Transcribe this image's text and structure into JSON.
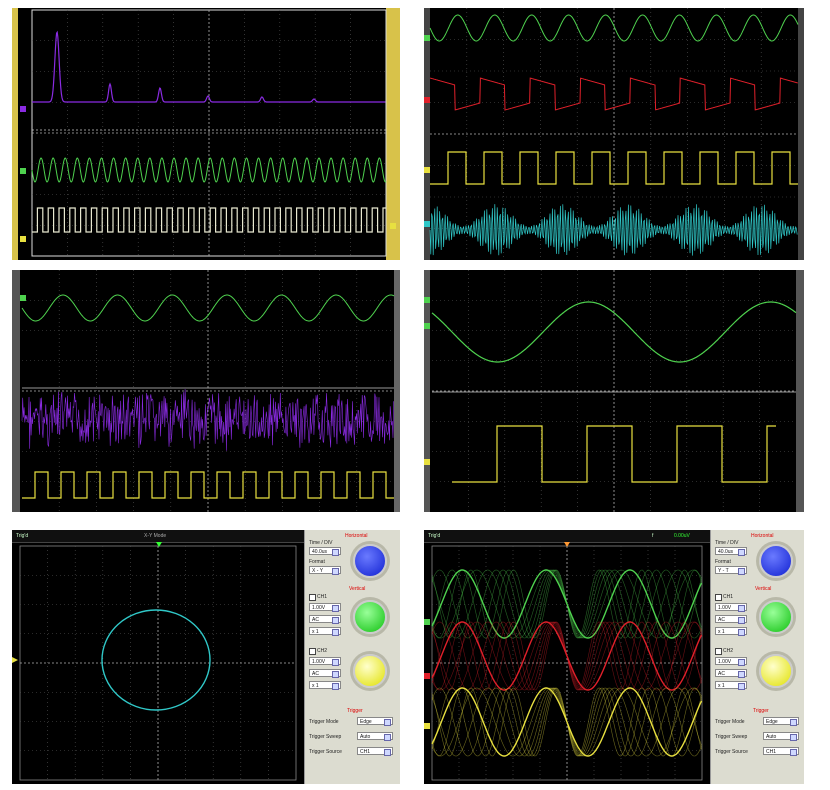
{
  "panels": [
    {
      "id": "p1",
      "desc": "fft-with-two-channels"
    },
    {
      "id": "p2",
      "desc": "four-channel-waveforms"
    },
    {
      "id": "p3",
      "desc": "sine-noise-square"
    },
    {
      "id": "p4",
      "desc": "sine-and-square"
    },
    {
      "id": "p5",
      "desc": "xy-mode-circle"
    },
    {
      "id": "p6",
      "desc": "persistence-display"
    }
  ],
  "colors": {
    "ch_purple": "#8a2be2",
    "ch_green": "#4fd24f",
    "ch_red": "#e0202a",
    "ch_yellow": "#e8e040",
    "ch_cyan": "#30c8c8",
    "grid": "#555555",
    "knob_blue": "#2030ff",
    "knob_green": "#20e020",
    "knob_yellow": "#f0f000"
  },
  "p5": {
    "topbar_left": "Trig'd",
    "topbar_mid": "X-Y Mode",
    "sidebar": {
      "horizontal": "Horizontal",
      "time_div_label": "Time / DIV",
      "time_div_value": "40.0us",
      "format_label": "Format",
      "format_value": "X - Y",
      "vertical": "Vertical",
      "ch1_label": "CH1",
      "ch1_volts": "1.00V",
      "ch1_coupling": "AC",
      "ch1_probe": "x 1",
      "ch2_label": "CH2",
      "ch2_volts": "1.00V",
      "ch2_coupling": "AC",
      "ch2_probe": "x 1",
      "trigger": "Trigger",
      "trigger_mode_label": "Trigger Mode",
      "trigger_mode_value": "Edge",
      "trigger_sweep_label": "Trigger Sweep",
      "trigger_sweep_value": "Auto",
      "trigger_source_label": "Trigger Source",
      "trigger_source_value": "CH1"
    }
  },
  "p6": {
    "topbar_left": "Trig'd",
    "topbar_right": "f",
    "topbar_right2": "0.00uV",
    "sidebar": {
      "horizontal": "Horizontal",
      "time_div_label": "Time / DIV",
      "time_div_value": "40.0us",
      "format_label": "Format",
      "format_value": "Y - T",
      "vertical": "Vertical",
      "ch1_label": "CH1",
      "ch1_volts": "1.00V",
      "ch1_coupling": "AC",
      "ch1_probe": "x 1",
      "ch2_label": "CH2",
      "ch2_volts": "1.00V",
      "ch2_coupling": "AC",
      "ch2_probe": "x 1",
      "trigger": "Trigger",
      "trigger_mode_label": "Trigger Mode",
      "trigger_mode_value": "Edge",
      "trigger_sweep_label": "Trigger Sweep",
      "trigger_sweep_value": "Auto",
      "trigger_source_label": "Trigger Source",
      "trigger_source_value": "CH1"
    }
  }
}
